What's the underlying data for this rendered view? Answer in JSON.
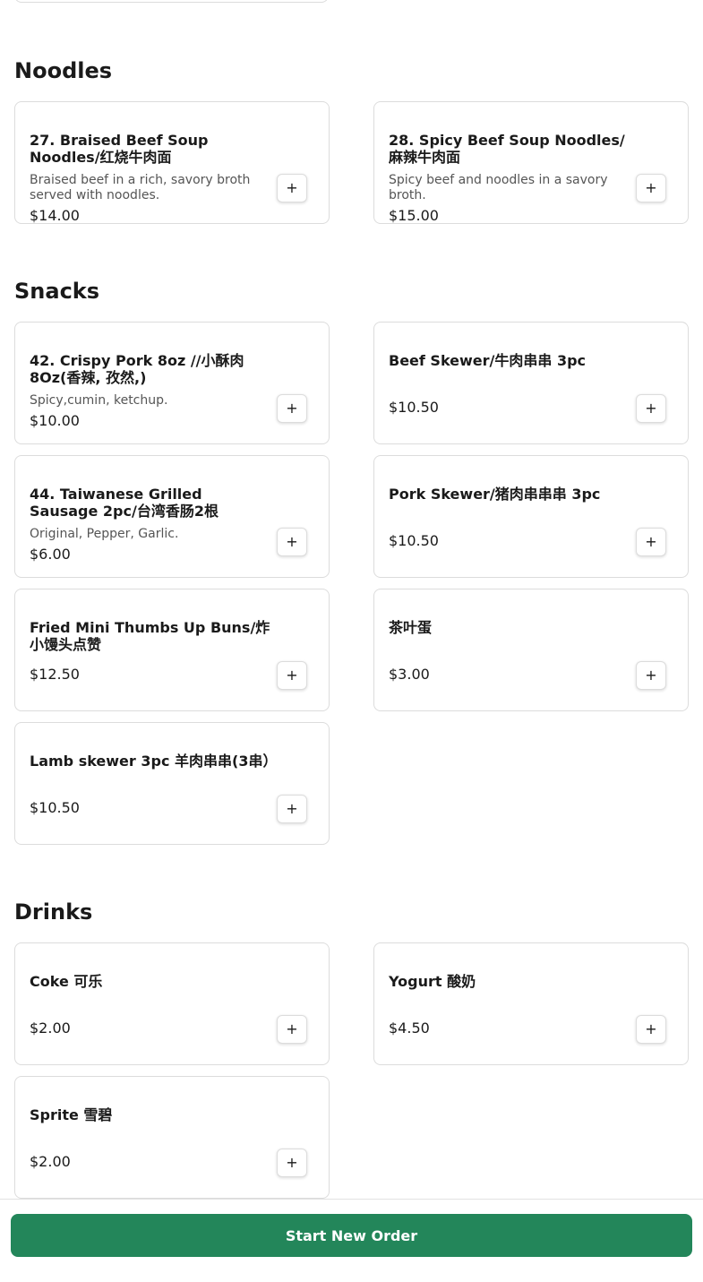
{
  "sections": {
    "noodles": {
      "title": "Noodles",
      "items": [
        {
          "name": "27. Braised Beef Soup Noodles/红烧牛肉面",
          "desc": "Braised beef in a rich, savory broth served with noodles.",
          "price": "$14.00"
        },
        {
          "name": "28. Spicy Beef Soup Noodles/麻辣牛肉面",
          "desc": "Spicy beef and noodles in a savory broth.",
          "price": "$15.00"
        }
      ]
    },
    "snacks": {
      "title": "Snacks",
      "items": [
        {
          "name": "42. Crispy Pork 8oz //小酥肉 8Oz(香辣, 孜然,)",
          "desc": "Spicy,cumin, ketchup.",
          "price": "$10.00"
        },
        {
          "name": "Beef Skewer/牛肉串串 3pc",
          "desc": "",
          "price": "$10.50"
        },
        {
          "name": "44. Taiwanese Grilled Sausage 2pc/台湾香肠2根",
          "desc": "Original, Pepper, Garlic.",
          "price": "$6.00"
        },
        {
          "name": "Pork Skewer/猪肉串串串 3pc",
          "desc": "",
          "price": "$10.50"
        },
        {
          "name": "Fried Mini Thumbs Up Buns/炸 小馒头点赞",
          "desc": "",
          "price": "$12.50"
        },
        {
          "name": "茶叶蛋",
          "desc": "",
          "price": "$3.00"
        },
        {
          "name": "Lamb skewer 3pc 羊肉串串(3串）",
          "desc": "",
          "price": "$10.50"
        }
      ]
    },
    "drinks": {
      "title": "Drinks",
      "items": [
        {
          "name": "Coke 可乐",
          "desc": "",
          "price": "$2.00"
        },
        {
          "name": "Yogurt 酸奶",
          "desc": "",
          "price": "$4.50"
        },
        {
          "name": "Sprite 雪碧",
          "desc": "",
          "price": "$2.00"
        }
      ]
    }
  },
  "add_button_label": "+",
  "footer": {
    "start_label": "Start New Order"
  },
  "colors": {
    "accent": "#23865a",
    "border": "#dcdcdc"
  }
}
